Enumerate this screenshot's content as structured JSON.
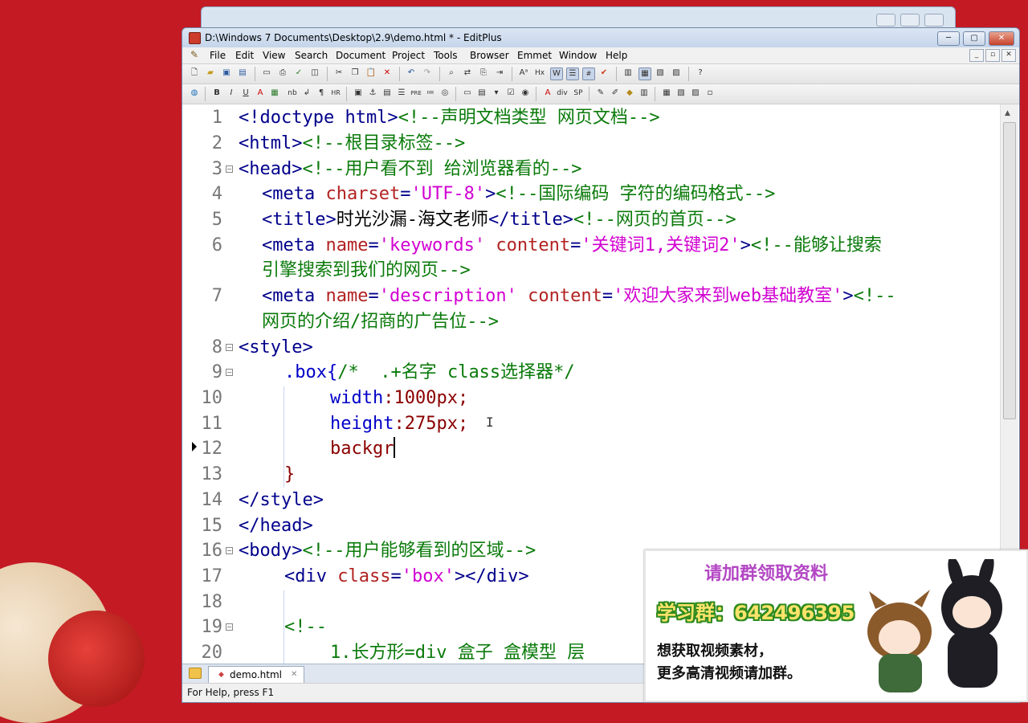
{
  "window": {
    "title": "D:\\Windows 7 Documents\\Desktop\\2.9\\demo.html * - EditPlus"
  },
  "menu": [
    "File",
    "Edit",
    "View",
    "Search",
    "Document",
    "Project",
    "Tools",
    "Browser",
    "Emmet",
    "Window",
    "Help"
  ],
  "toolbar2_text": {
    "nb": "nb",
    "hr": "HR",
    "div": "div",
    "sp": "SP",
    "pre": "PRE",
    "hx": "Hx"
  },
  "editor": {
    "lines": [
      {
        "num": "1"
      },
      {
        "num": "2"
      },
      {
        "num": "3"
      },
      {
        "num": "4"
      },
      {
        "num": "5"
      },
      {
        "num": "6"
      },
      {
        "num": "7"
      },
      {
        "num": "8"
      },
      {
        "num": "9"
      },
      {
        "num": "10"
      },
      {
        "num": "11"
      },
      {
        "num": "12"
      },
      {
        "num": "13"
      },
      {
        "num": "14"
      },
      {
        "num": "15"
      },
      {
        "num": "16"
      },
      {
        "num": "17"
      },
      {
        "num": "18"
      },
      {
        "num": "19"
      },
      {
        "num": "20"
      }
    ],
    "code": {
      "l1": [
        "<!doctype html>",
        "<!--声明文档类型 网页文档-->"
      ],
      "l2": [
        "<html>",
        "<!--根目录标签-->"
      ],
      "l3": [
        "<head>",
        "<!--用户看不到 给浏览器看的-->"
      ],
      "l4": [
        "<meta ",
        "charset",
        "=",
        "'UTF-8'",
        ">",
        "<!--国际编码 字符的编码格式-->"
      ],
      "l5": [
        "<title>",
        "时光沙漏-海文老师",
        "</title>",
        "<!--网页的首页-->"
      ],
      "l6a": [
        "<meta ",
        "name",
        "=",
        "'keywords'",
        " ",
        "content",
        "=",
        "'关键词1,关键词2'",
        ">",
        "<!--能够让搜索"
      ],
      "l6b": "引擎搜索到我们的网页-->",
      "l7a": [
        "<meta ",
        "name",
        "=",
        "'description'",
        " ",
        "content",
        "=",
        "'欢迎大家来到web基础教室'",
        ">",
        "<!--"
      ],
      "l7b": "网页的介绍/招商的广告位-->",
      "l8": "<style>",
      "l9": [
        ".box{",
        "/*  .+名字 class选择器*/"
      ],
      "l10": [
        "width",
        ":1000px;"
      ],
      "l11": [
        "height",
        ":275px;"
      ],
      "l12": "backgr",
      "l13": "}",
      "l14": "</style>",
      "l15": "</head>",
      "l16": [
        "<body>",
        "<!--用户能够看到的区域-->"
      ],
      "l17": [
        "<div ",
        "class",
        "=",
        "'box'",
        "></div>"
      ],
      "l19": "<!--",
      "l20": "1.长方形=div 盒子 盒模型 层"
    }
  },
  "tab": {
    "label": "demo.html"
  },
  "status": "For Help, press F1",
  "ad": {
    "title": "请加群领取资料",
    "group": "学习群：642496395",
    "line1": "想获取视频素材，",
    "line2": "更多高清视频请加群。"
  },
  "colors": {
    "background": "#c41a24",
    "tag": "#00008b",
    "attribute": "#b22222",
    "string": "#d100d1",
    "comment": "#0a7a0a",
    "property": "#0000c8"
  }
}
